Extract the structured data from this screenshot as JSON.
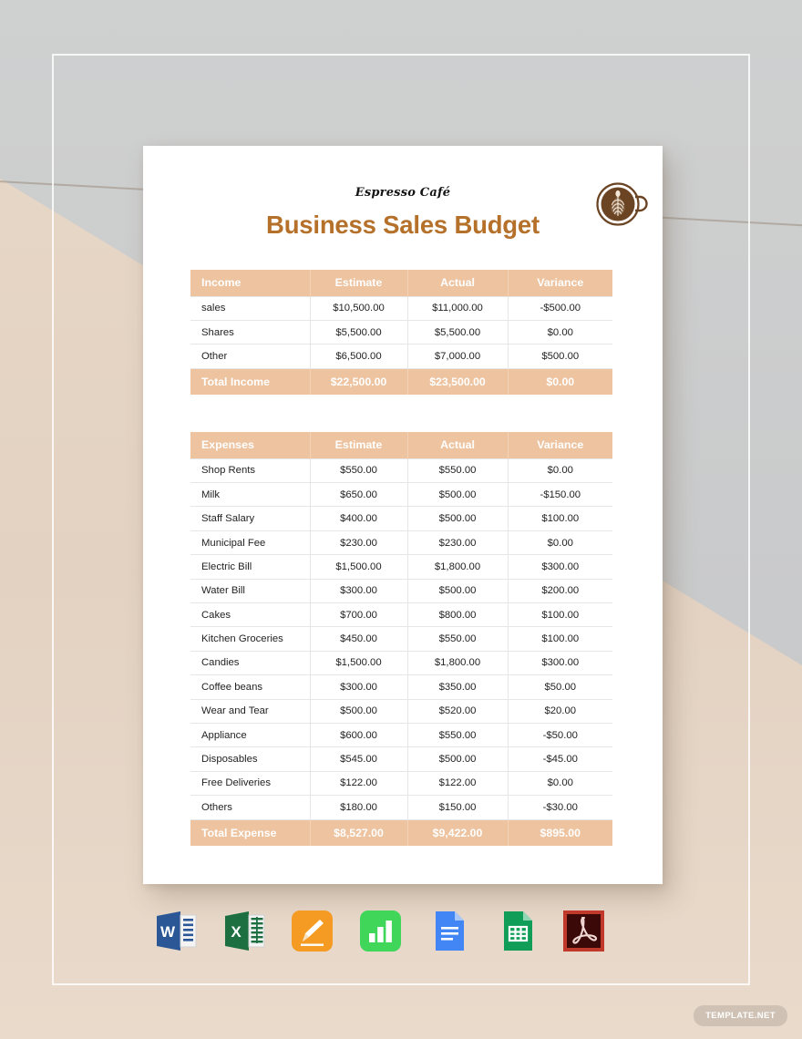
{
  "document": {
    "brand": "Espresso Café",
    "title": "Business Sales Budget",
    "logo_icon": "coffee-cup-latte-icon",
    "title_color": "#b5702a",
    "header_fill": "#edc3a0"
  },
  "income_table": {
    "columns": [
      "Income",
      "Estimate",
      "Actual",
      "Variance"
    ],
    "rows": [
      {
        "label": "sales",
        "estimate": "$10,500.00",
        "actual": "$11,000.00",
        "variance": "-$500.00"
      },
      {
        "label": "Shares",
        "estimate": "$5,500.00",
        "actual": "$5,500.00",
        "variance": "$0.00"
      },
      {
        "label": "Other",
        "estimate": "$6,500.00",
        "actual": "$7,000.00",
        "variance": "$500.00"
      }
    ],
    "total": {
      "label": "Total Income",
      "estimate": "$22,500.00",
      "actual": "$23,500.00",
      "variance": "$0.00"
    }
  },
  "expenses_table": {
    "columns": [
      "Expenses",
      "Estimate",
      "Actual",
      "Variance"
    ],
    "rows": [
      {
        "label": "Shop Rents",
        "estimate": "$550.00",
        "actual": "$550.00",
        "variance": "$0.00"
      },
      {
        "label": "Milk",
        "estimate": "$650.00",
        "actual": "$500.00",
        "variance": "-$150.00"
      },
      {
        "label": "Staff Salary",
        "estimate": "$400.00",
        "actual": "$500.00",
        "variance": "$100.00"
      },
      {
        "label": "Municipal Fee",
        "estimate": "$230.00",
        "actual": "$230.00",
        "variance": "$0.00"
      },
      {
        "label": "Electric Bill",
        "estimate": "$1,500.00",
        "actual": "$1,800.00",
        "variance": "$300.00"
      },
      {
        "label": "Water Bill",
        "estimate": "$300.00",
        "actual": "$500.00",
        "variance": "$200.00"
      },
      {
        "label": "Cakes",
        "estimate": "$700.00",
        "actual": "$800.00",
        "variance": "$100.00"
      },
      {
        "label": "Kitchen Groceries",
        "estimate": "$450.00",
        "actual": "$550.00",
        "variance": "$100.00"
      },
      {
        "label": "Candies",
        "estimate": "$1,500.00",
        "actual": "$1,800.00",
        "variance": "$300.00"
      },
      {
        "label": "Coffee beans",
        "estimate": "$300.00",
        "actual": "$350.00",
        "variance": "$50.00"
      },
      {
        "label": "Wear and Tear",
        "estimate": "$500.00",
        "actual": "$520.00",
        "variance": "$20.00"
      },
      {
        "label": "Appliance",
        "estimate": "$600.00",
        "actual": "$550.00",
        "variance": "-$50.00"
      },
      {
        "label": "Disposables",
        "estimate": "$545.00",
        "actual": "$500.00",
        "variance": "-$45.00"
      },
      {
        "label": "Free Deliveries",
        "estimate": "$122.00",
        "actual": "$122.00",
        "variance": "$0.00"
      },
      {
        "label": "Others",
        "estimate": "$180.00",
        "actual": "$150.00",
        "variance": "-$30.00"
      }
    ],
    "total": {
      "label": "Total Expense",
      "estimate": "$8,527.00",
      "actual": "$9,422.00",
      "variance": "$895.00"
    }
  },
  "format_icons": [
    {
      "name": "microsoft-word-icon",
      "letter": "W"
    },
    {
      "name": "microsoft-excel-icon",
      "letter": "X"
    },
    {
      "name": "apple-pages-icon",
      "letter": ""
    },
    {
      "name": "apple-numbers-icon",
      "letter": ""
    },
    {
      "name": "google-docs-icon",
      "letter": ""
    },
    {
      "name": "google-sheets-icon",
      "letter": ""
    },
    {
      "name": "adobe-pdf-icon",
      "letter": ""
    }
  ],
  "watermark": {
    "label": "TEMPLATE.NET"
  }
}
